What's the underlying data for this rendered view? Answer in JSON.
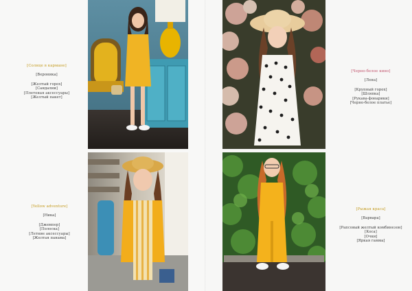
{
  "spread": {
    "left_page": {
      "top_caption": {
        "title": "[Солнце в кармане]",
        "title_color": "#c39a1d",
        "name": "[Вероника]",
        "items": [
          "[Желтый горох]",
          "[Сандалии]",
          "[Плетеная аксессуары]",
          "[Желтый пакет]"
        ]
      },
      "bottom_caption": {
        "title": "[Yellow adventure]",
        "title_color": "#c39a1d",
        "name": "[Ника]",
        "items": [
          "[Джемпер]",
          "[Полоска]",
          "[Летние аксессуары]",
          "[Желтая панама]"
        ]
      }
    },
    "right_page": {
      "top_caption": {
        "title": "[Черно-белое кино]",
        "title_color": "#c0506a",
        "name": "[Лена]",
        "items": [
          "[Крупный горох]",
          "[Шляпка]",
          "[Рукава-фонарики]",
          "[Черно-белое платье]"
        ]
      },
      "bottom_caption": {
        "title": "[Рыжая краса]",
        "title_color": "#c39a1d",
        "name": "[Варвара]",
        "items": [
          "[Рапсовый желтый комбинезон]",
          "[Коса]",
          "[Очки]",
          "[Яркая гамма]"
        ]
      }
    }
  }
}
